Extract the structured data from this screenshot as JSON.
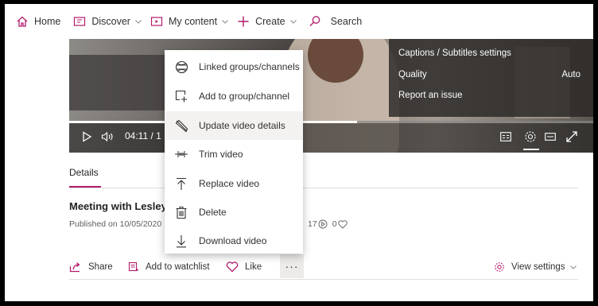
{
  "nav": {
    "home": "Home",
    "discover": "Discover",
    "my_content": "My content",
    "create": "Create",
    "search": "Search"
  },
  "player": {
    "settings_panel": {
      "captions": "Captions / Subtitles settings",
      "quality": "Quality",
      "quality_value": "Auto",
      "report": "Report an issue"
    },
    "time": "04:11 / 1",
    "progress_fraction": 0.55
  },
  "details": {
    "tab": "Details",
    "title": "Meeting with Lesley",
    "published": "Published on 10/05/2020",
    "views": "17",
    "likes": "0"
  },
  "actions": {
    "share": "Share",
    "watchlist": "Add to watchlist",
    "like": "Like",
    "more": "···",
    "view_settings": "View settings"
  },
  "menu": {
    "items": [
      {
        "label": "Linked groups/channels",
        "icon": "globe-icon"
      },
      {
        "label": "Add to group/channel",
        "icon": "add-to-group-icon"
      },
      {
        "label": "Update video details",
        "icon": "pencil-icon"
      },
      {
        "label": "Trim video",
        "icon": "trim-icon"
      },
      {
        "label": "Replace video",
        "icon": "replace-upload-icon"
      },
      {
        "label": "Delete",
        "icon": "trash-icon"
      },
      {
        "label": "Download video",
        "icon": "download-icon"
      }
    ]
  },
  "colors": {
    "accent": "#b4196b",
    "menu_highlight": "#f3f2f1"
  }
}
